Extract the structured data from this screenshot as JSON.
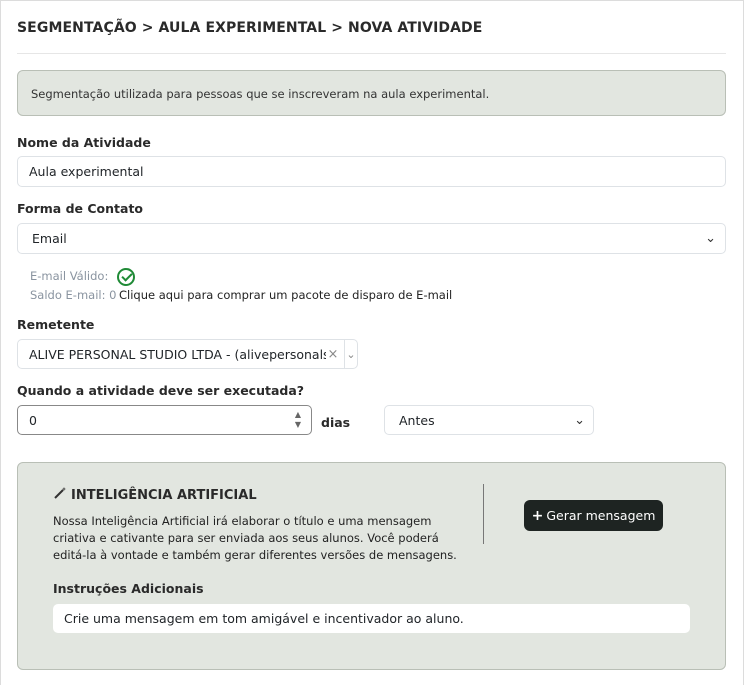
{
  "breadcrumb": "SEGMENTAÇÃO > AULA EXPERIMENTAL > NOVA ATIVIDADE",
  "info_message": "Segmentação utilizada para pessoas que se inscreveram na aula experimental.",
  "activity_name": {
    "label": "Nome da Atividade",
    "value": "Aula experimental"
  },
  "contact_form": {
    "label": "Forma de Contato",
    "selected": "Email"
  },
  "email_status": {
    "valid_label": "E-mail Válido:",
    "balance_label": "Saldo E-mail: 0",
    "buy_link": "Clique aqui para comprar um pacote de disparo de E-mail"
  },
  "sender": {
    "label": "Remetente",
    "selected": "ALIVE PERSONAL STUDIO LTDA - (alivepersonals...",
    "clear_icon": "×"
  },
  "schedule": {
    "label": "Quando a atividade deve ser executada?",
    "value": "0",
    "unit": "dias",
    "when_selected": "Antes"
  },
  "ai": {
    "title": "INTELIGÊNCIA ARTIFICIAL",
    "icon": "magic-wand-icon",
    "description": "Nossa Inteligência Artificial irá elaborar o título e uma mensagem criativa e cativante para ser enviada aos seus alunos. Você poderá editá-la à vontade e também gerar diferentes versões de mensagens.",
    "generate_button": "Gerar mensagem",
    "instructions_label": "Instruções Adicionais",
    "instructions_value": "Crie uma mensagem em tom amigável e incentivador ao aluno."
  },
  "colors": {
    "panel_bg": "#e2e6e0",
    "button_bg": "#1e2422",
    "valid_green": "#1f8a36"
  }
}
